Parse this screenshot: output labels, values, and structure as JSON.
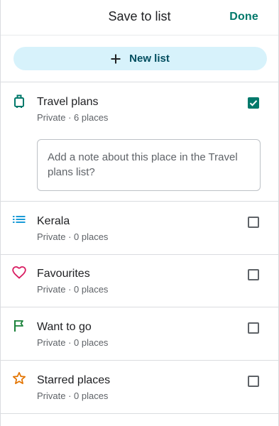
{
  "header": {
    "title": "Save to list",
    "done_label": "Done"
  },
  "new_list": {
    "label": "New list",
    "icon": "plus-icon"
  },
  "note": {
    "placeholder": "Add a note about this place in the Travel plans list?"
  },
  "lists": [
    {
      "name": "Travel plans",
      "meta": "Private · 6 places",
      "icon": "luggage-icon",
      "icon_color": "#00796b",
      "checked": true
    },
    {
      "name": "Kerala",
      "meta": "Private · 0 places",
      "icon": "list-icon",
      "icon_color": "#1a9bd7",
      "checked": false
    },
    {
      "name": "Favourites",
      "meta": "Private · 0 places",
      "icon": "heart-icon",
      "icon_color": "#d81b60",
      "checked": false
    },
    {
      "name": "Want to go",
      "meta": "Private · 0 places",
      "icon": "flag-icon",
      "icon_color": "#188038",
      "checked": false
    },
    {
      "name": "Starred places",
      "meta": "Private · 0 places",
      "icon": "star-icon",
      "icon_color": "#e37400",
      "checked": false
    }
  ],
  "colors": {
    "accent": "#00796b",
    "new_list_bg": "#d7f2fb",
    "new_list_text": "#004d5f"
  }
}
